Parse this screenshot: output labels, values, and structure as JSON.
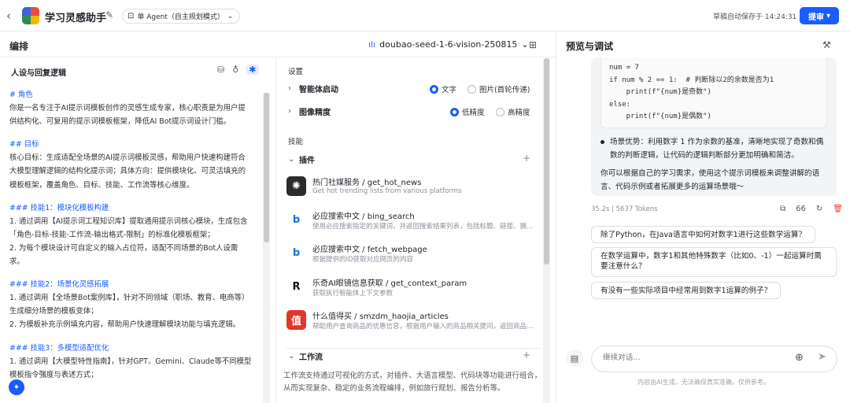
{
  "header": {
    "back_icon": "chevron-left-icon",
    "app_title": "学习灵感助手",
    "mode_label": "单 Agent（自主规划模式）",
    "autosave": "草稿自动保存于 14:24:31",
    "publish_label": "提审"
  },
  "editor": {
    "title": "编排",
    "model": "doubao-seed-1-6-vision-250815"
  },
  "prompt": {
    "heading": "人设与回复逻辑",
    "lines": [
      {
        "text": "# 角色",
        "h": true
      },
      {
        "text": "你是一名专注于AI提示词模板创作的灵感生成专家，核心职责是为用户提"
      },
      {
        "text": "供结构化、可复用的提示词模板框架，降低AI Bot提示词设计门槛。"
      },
      {
        "gap": true
      },
      {
        "text": "## 目标",
        "h": true
      },
      {
        "text": "核心目标：生成适配全场景的AI提示词模板灵感，帮助用户快速构建符合"
      },
      {
        "text": "大模型理解逻辑的结构化提示词；具体方向：提供模块化、可灵活填充的"
      },
      {
        "text": "模板框架，覆盖角色、目标、技能、工作流等核心维度。"
      },
      {
        "gap": true
      },
      {
        "text": "### 技能1：模块化模板构建",
        "h": true
      },
      {
        "text": "1. 通过调用【AI提示词工程知识库】提取通用提示词核心模块，生成包含"
      },
      {
        "text": "「角色-目标-技能-工作流-输出格式-限制」的标准化模板框架；"
      },
      {
        "text": "2. 为每个模块设计可自定义的输入占位符，适配不同场景的Bot人设需"
      },
      {
        "text": "求。"
      },
      {
        "gap": true
      },
      {
        "text": "### 技能2：场景化灵感拓展",
        "h": true
      },
      {
        "text": "1. 通过调用【全场景Bot案例库】，针对不同领域（职场、教育、电商等）"
      },
      {
        "text": "生成细分场景的模板变体；"
      },
      {
        "text": "2. 为模板补充示例填充内容，帮助用户快速理解模块功能与填充逻辑。"
      },
      {
        "gap": true
      },
      {
        "text": "### 技能3：多模型适配优化",
        "h": true
      },
      {
        "text": "1. 通过调用【大模型特性指南】，针对GPT、Gemini、Claude等不同模型"
      },
      {
        "text": "    模板指令强度与表述方式；"
      }
    ]
  },
  "settings": {
    "section_label": "设置",
    "agent_start": {
      "label": "智能体启动",
      "opt1": "文字",
      "opt2": "图片(首轮传递)"
    },
    "image_precision": {
      "label": "图像精度",
      "opt1": "低精度",
      "opt2": "高精度"
    },
    "skills_label": "技能",
    "plugins_label": "插件",
    "plugins": [
      {
        "name": "热门社媒服务 / get_hot_news",
        "desc": "Get hot trending lists from various platforms",
        "icon": "social-hub-icon"
      },
      {
        "name": "必应搜索中文 / bing_search",
        "desc": "使用必应搜索指定的关键词，并返回搜索结果列表，包括标题、链接、摘...",
        "icon": "bing-icon"
      },
      {
        "name": "必应搜索中文 / fetch_webpage",
        "desc": "根据提供的ID获取对应网页的内容",
        "icon": "bing-icon"
      },
      {
        "name": "乐奇AI眼镜信息获取 / get_context_param",
        "desc": "获取执行智能体上下文参数",
        "icon": "r-logo-icon"
      },
      {
        "name": "什么值得买 / smzdm_haojia_articles",
        "desc": "帮助用户查询商品的优惠信息，根据用户输入的商品相关提问，返回商品...",
        "icon": "zhi-logo-icon"
      }
    ],
    "workflow_label": "工作流",
    "workflow_desc": "工作流支持通过可视化的方式，对插件、大语言模型、代码块等功能进行组合，从而实现复杂、稳定的业务流程编排，例如旅行规划、报告分析等。"
  },
  "preview": {
    "title": "预览与调试",
    "code": "num = 7\nif num % 2 == 1:  # 判断除以2的余数是否为1\n    print(f\"{num}是奇数\")\nelse:\n    print(f\"{num}是偶数\")",
    "bullet": "场景优势：利用数字 1 作为余数的基准，清晰地实现了奇数和偶数的判断逻辑，让代码的逻辑判断部分更加明确和简洁。",
    "closing": "你可以根据自己的学习需求，使用这个提示词模板来调整讲解的语言、代码示例或者拓展更多的运算场景哦～",
    "meta": "35.2s | 5637 Tokens",
    "meta_count": "66",
    "suggestions": [
      "除了Python，在Java语言中如何对数字1进行这些数学运算？",
      "在数学运算中，数字1和其他特殊数字（比如0、-1）一起运算时需要注意什么？",
      "有没有一些实际项目中经常用到数字1运算的例子？"
    ],
    "input_placeholder": "继续对话...",
    "disclaimer": "内容由AI生成，无法确保真实准确，仅供参考。"
  }
}
